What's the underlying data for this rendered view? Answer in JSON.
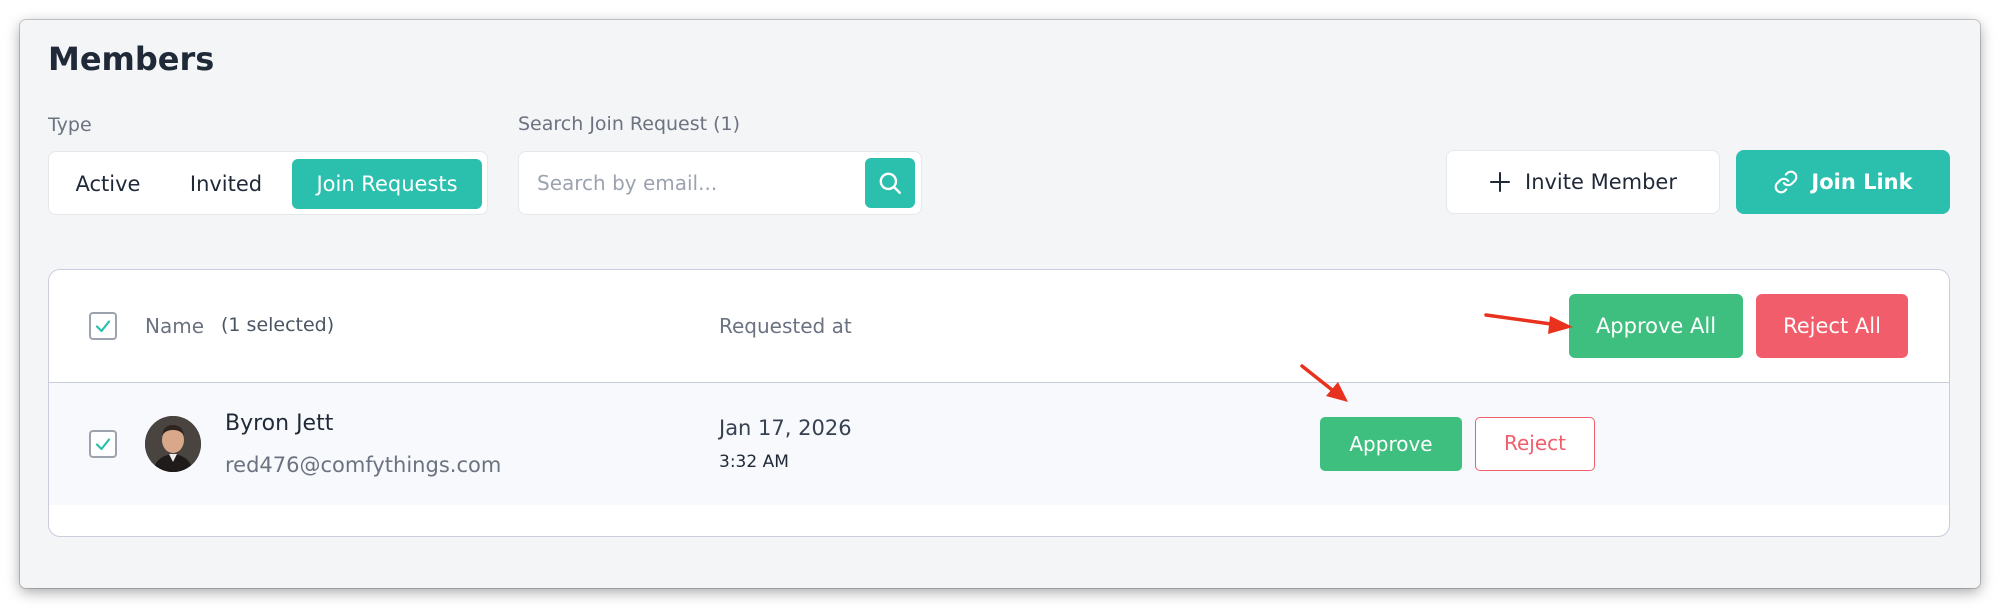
{
  "header": {
    "title": "Members"
  },
  "filters": {
    "type_label": "Type",
    "type_options": [
      "Active",
      "Invited",
      "Join Requests"
    ],
    "selected_type": "Join Requests",
    "search_label": "Search Join Request (1)",
    "search_placeholder": "Search by email...",
    "search_value": ""
  },
  "actions": {
    "invite_member": "Invite Member",
    "join_link": "Join Link"
  },
  "table": {
    "columns": {
      "name": "Name",
      "selected_count": "(1 selected)",
      "requested_at": "Requested at"
    },
    "header_select_all_checked": true,
    "approve_all": "Approve All",
    "reject_all": "Reject All",
    "rows": [
      {
        "checked": true,
        "name": "Byron Jett",
        "email": "red476@comfythings.com",
        "requested_date": "Jan 17, 2026",
        "requested_time": "3:32 AM",
        "approve_label": "Approve",
        "reject_label": "Reject"
      }
    ]
  },
  "colors": {
    "accent": "#2bbfae",
    "approve": "#3fbf7f",
    "reject": "#f25d6b",
    "annotation_arrow": "#e8321e"
  },
  "icons": {
    "search": "search-icon",
    "invite": "plus-icon",
    "join_link": "link-icon",
    "checkbox": "check-icon"
  }
}
